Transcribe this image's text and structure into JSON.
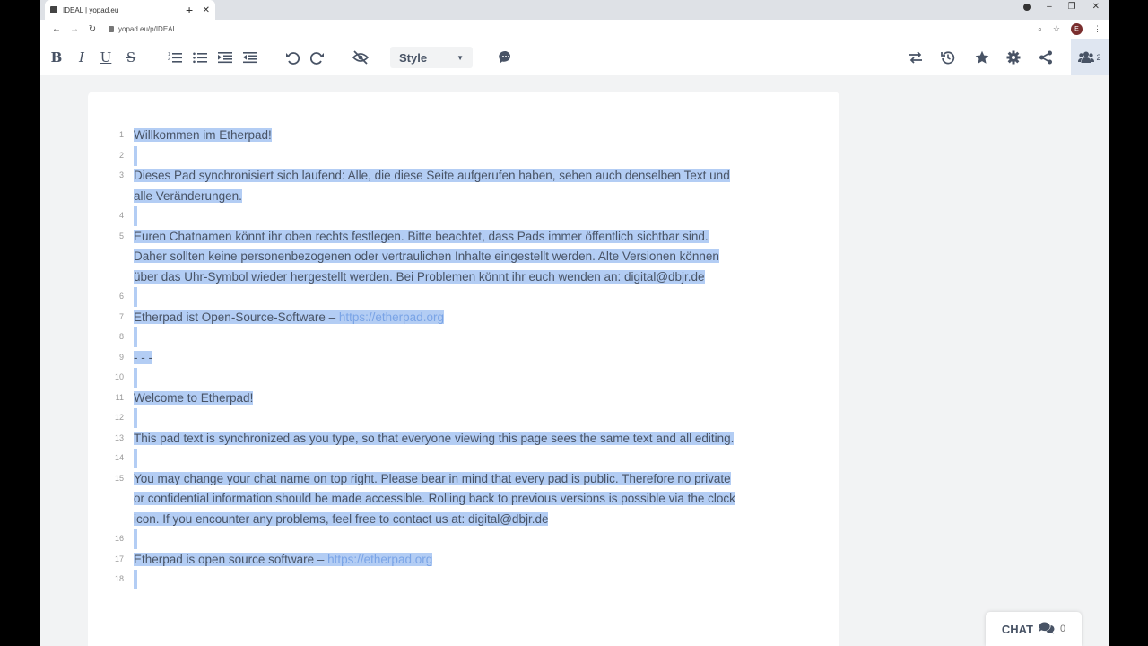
{
  "browser": {
    "tab_title": "IDEAL | yopad.eu",
    "url": "yopad.eu/p/IDEAL",
    "avatar_letter": "E"
  },
  "toolbar": {
    "bold": "B",
    "italic": "I",
    "underline": "U",
    "strike": "S",
    "style_label": "Style",
    "users_count": "2"
  },
  "lines": [
    {
      "num": "1",
      "text": "Willkommen im Etherpad!"
    },
    {
      "num": "2",
      "text": ""
    },
    {
      "num": "3",
      "text": "Dieses Pad synchronisiert sich laufend: Alle, die diese Seite aufgerufen haben, sehen auch denselben Text und",
      "cont": [
        "alle Veränderungen."
      ]
    },
    {
      "num": "4",
      "text": ""
    },
    {
      "num": "5",
      "text": "Euren Chatnamen könnt ihr oben rechts festlegen. Bitte beachtet, dass Pads immer öffentlich sichtbar sind.",
      "cont": [
        "Daher sollten keine personenbezogenen oder vertraulichen Inhalte eingestellt werden. Alte Versionen können",
        "über das Uhr-Symbol wieder hergestellt werden. Bei Problemen könnt ihr euch wenden an: digital@dbjr.de"
      ]
    },
    {
      "num": "6",
      "text": ""
    },
    {
      "num": "7",
      "text": "Etherpad ist Open-Source-Software – ",
      "link": "https://etherpad.org"
    },
    {
      "num": "8",
      "text": ""
    },
    {
      "num": "9",
      "text": "- - -"
    },
    {
      "num": "10",
      "text": ""
    },
    {
      "num": "11",
      "text": "Welcome to Etherpad!"
    },
    {
      "num": "12",
      "text": ""
    },
    {
      "num": "13",
      "text": "This pad text is synchronized as you type, so that everyone viewing this page sees the same text and all editing."
    },
    {
      "num": "14",
      "text": ""
    },
    {
      "num": "15",
      "text": "You may change your chat name on top right. Please bear in mind that every pad is public. Therefore no private",
      "cont": [
        "or confidential information should be made accessible. Rolling back to previous versions is possible via the clock",
        "icon. If you encounter any problems, feel free to contact us at: digital@dbjr.de"
      ]
    },
    {
      "num": "16",
      "text": ""
    },
    {
      "num": "17",
      "text": "Etherpad is open source software – ",
      "link": "https://etherpad.org"
    },
    {
      "num": "18",
      "text": ""
    }
  ],
  "chat": {
    "label": "CHAT",
    "count": "0"
  },
  "icons": [
    "ordered-list-icon",
    "unordered-list-icon",
    "indent-icon",
    "outdent-icon",
    "undo-icon",
    "redo-icon",
    "eye-slash-icon",
    "comment-icon",
    "import-export-icon",
    "history-icon",
    "star-icon",
    "gear-icon",
    "share-icon",
    "users-icon",
    "chat-icon"
  ],
  "colors": {
    "selection": "#b3cdf4",
    "text": "#485365",
    "link": "#7aa4e6"
  }
}
